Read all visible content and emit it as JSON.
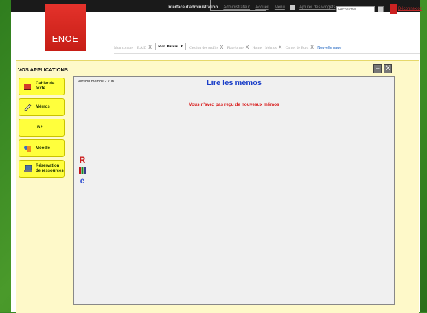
{
  "topbar": {
    "admin_link": "Interface d'administration",
    "user_name": "Administrateur",
    "home_link": "Accueil",
    "menu_link": "Menu",
    "add_widget_link": "Ajouter des widgets",
    "search_placeholder": "Rechercher",
    "logout_link": "Déconnexion"
  },
  "logo": {
    "text": "ENOE"
  },
  "tabs": [
    {
      "label": "Mon compte",
      "closable": false
    },
    {
      "label": "E.A.D",
      "closable": true
    },
    {
      "label": "Mon Bureau",
      "closable": false,
      "active": true
    },
    {
      "label": "Gestion des profils",
      "closable": true
    },
    {
      "label": "Plateforme",
      "closable": true
    },
    {
      "label": "Home",
      "closable": false
    },
    {
      "label": "Mémos",
      "closable": true
    },
    {
      "label": "Carnet de Bord",
      "closable": true
    },
    {
      "label": "Nouvelle page",
      "closable": false
    }
  ],
  "apps": {
    "title": "VOS APPLICATIONS",
    "items": [
      {
        "label_line1": "Cahier de",
        "label_line2": "texte"
      },
      {
        "label_line1": "Mémos",
        "label_line2": ""
      },
      {
        "label_line1": "B2i",
        "label_line2": ""
      },
      {
        "label_line1": "Moodle",
        "label_line2": ""
      },
      {
        "label_line1": "Réservation",
        "label_line2": "de ressources"
      }
    ]
  },
  "window_buttons": {
    "minimize": "–",
    "close": "X"
  },
  "memos": {
    "version": "Version mémos 2.7.ih",
    "title": "Lire les mémos",
    "message": "Vous n'avez pas reçu de nouveaux mémos"
  },
  "side_icons": [
    "R",
    "books",
    "e"
  ],
  "colors": {
    "accent_red": "#e4322b",
    "app_button_yellow": "#ffff3c",
    "panel_bg": "#fef9c9",
    "title_blue": "#1b3fc8",
    "message_red": "#d81818",
    "link_blue": "#2a6cc4"
  }
}
